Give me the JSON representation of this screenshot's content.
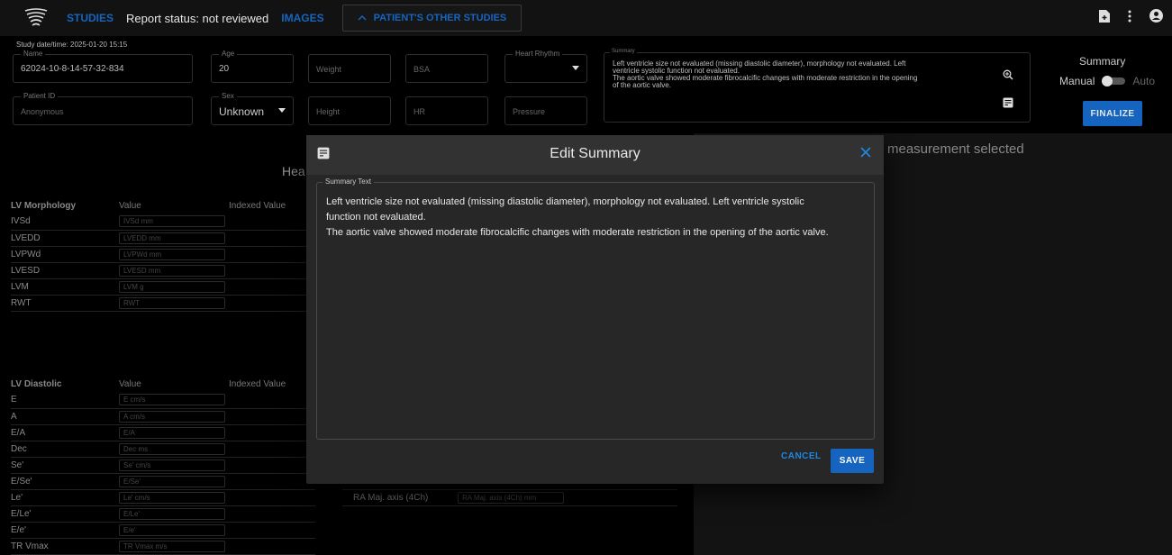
{
  "topbar": {
    "studies": "STUDIES",
    "report_status": "Report status: not reviewed",
    "images": "IMAGES",
    "other_studies": "PATIENT'S OTHER STUDIES"
  },
  "patient": {
    "study_datetime": "Study date/time: 2025-01-20 15:15",
    "name_label": "Name",
    "name_value": "62024-10-8-14-57-32-834",
    "age_label": "Age",
    "age_value": "20",
    "weight_placeholder": "Weight",
    "bsa_placeholder": "BSA",
    "heart_rhythm_label": "Heart Rhythm",
    "patient_id_label": "Patient ID",
    "patient_id_value": "Anonymous",
    "sex_label": "Sex",
    "sex_value": "Unknown",
    "height_placeholder": "Height",
    "hr_placeholder": "HR",
    "pressure_placeholder": "Pressure"
  },
  "summary_panel": {
    "label": "Summary",
    "lines": [
      "Left ventricle size not evaluated (missing diastolic diameter), morphology not evaluated. Left",
      "ventricle systolic function not evaluated.",
      "The aortic valve showed moderate fibrocalcific changes with moderate restriction in the opening",
      "of the aortic valve."
    ]
  },
  "summary_mode": {
    "title": "Summary",
    "manual": "Manual",
    "auto": "Auto",
    "finalize": "FINALIZE"
  },
  "main": {
    "no_measurement": "measurement selected",
    "heart_title": "Hea",
    "lv_morph": {
      "headers": [
        "LV Morphology",
        "Value",
        "Indexed Value"
      ],
      "rows": [
        {
          "name": "IVSd",
          "ph": "IVSd mm"
        },
        {
          "name": "LVEDD",
          "ph": "LVEDD mm"
        },
        {
          "name": "LVPWd",
          "ph": "LVPWd mm"
        },
        {
          "name": "LVESD",
          "ph": "LVESD mm"
        },
        {
          "name": "LVM",
          "ph": "LVM g"
        },
        {
          "name": "RWT",
          "ph": "RWT"
        }
      ]
    },
    "lv_diast": {
      "headers": [
        "LV Diastolic",
        "Value",
        "Indexed Value"
      ],
      "rows": [
        {
          "name": "E",
          "ph": "E cm/s"
        },
        {
          "name": "A",
          "ph": "A cm/s"
        },
        {
          "name": "E/A",
          "ph": "E/A"
        },
        {
          "name": "Dec",
          "ph": "Dec ms"
        },
        {
          "name": "Se'",
          "ph": "Se' cm/s"
        },
        {
          "name": "E/Se'",
          "ph": "E/Se'"
        },
        {
          "name": "Le'",
          "ph": "Le' cm/s"
        },
        {
          "name": "E/Le'",
          "ph": "E/Le'"
        },
        {
          "name": "E/e'",
          "ph": "E/e'"
        },
        {
          "name": "TR Vmax",
          "ph": "TR Vmax m/s"
        }
      ]
    },
    "ra": {
      "name": "RA Maj. axis (4Ch)",
      "ph": "RA Maj. axis (4Ch) mm"
    }
  },
  "dialog": {
    "title": "Edit Summary",
    "field_label": "Summary Text",
    "lines": [
      "Left ventricle size not evaluated (missing diastolic diameter), morphology not evaluated. Left ventricle systolic",
      "function not evaluated.",
      "The aortic valve showed moderate fibrocalcific changes with moderate restriction in the opening of the aortic valve."
    ],
    "cancel": "CANCEL",
    "save": "SAVE"
  },
  "colors": {
    "accent": "#1565c0",
    "link": "#1e88e5",
    "dialog_bg": "#272727"
  }
}
